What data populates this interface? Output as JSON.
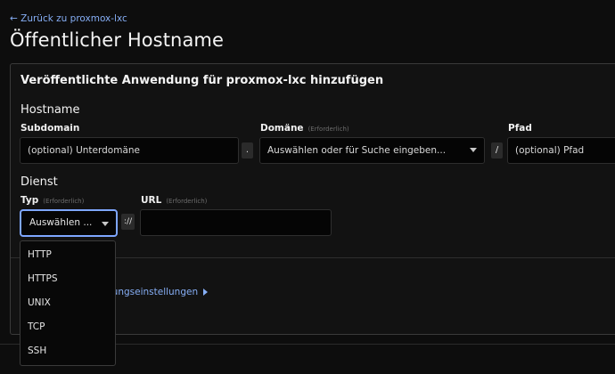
{
  "nav": {
    "back_link": "← Zurück zu proxmox-lxc"
  },
  "page": {
    "title": "Öffentlicher Hostname"
  },
  "card": {
    "title": "Veröffentlichte Anwendung für proxmox-lxc hinzufügen",
    "hostname": {
      "section_title": "Hostname",
      "subdomain": {
        "label": "Subdomain",
        "placeholder": "(optional) Unterdomäne"
      },
      "dot_separator": ".",
      "domain": {
        "label": "Domäne",
        "required": "(Erforderlich)",
        "placeholder": "Auswählen oder für Suche eingeben..."
      },
      "slash_separator": "/",
      "path": {
        "label": "Pfad",
        "placeholder": "(optional) Pfad"
      }
    },
    "service": {
      "section_title": "Dienst",
      "type": {
        "label": "Typ",
        "required": "(Erforderlich)",
        "value": "Auswählen ...",
        "options": [
          "HTTP",
          "HTTPS",
          "UNIX",
          "TCP",
          "SSH"
        ]
      },
      "scheme_separator": "://",
      "url": {
        "label": "URL",
        "required": "(Erforderlich)",
        "value": ""
      }
    },
    "advanced_link": "dungseinstellungen"
  },
  "colors": {
    "accent": "#7ea6ff",
    "link": "#86aef5",
    "background": "#0d0d0d"
  }
}
